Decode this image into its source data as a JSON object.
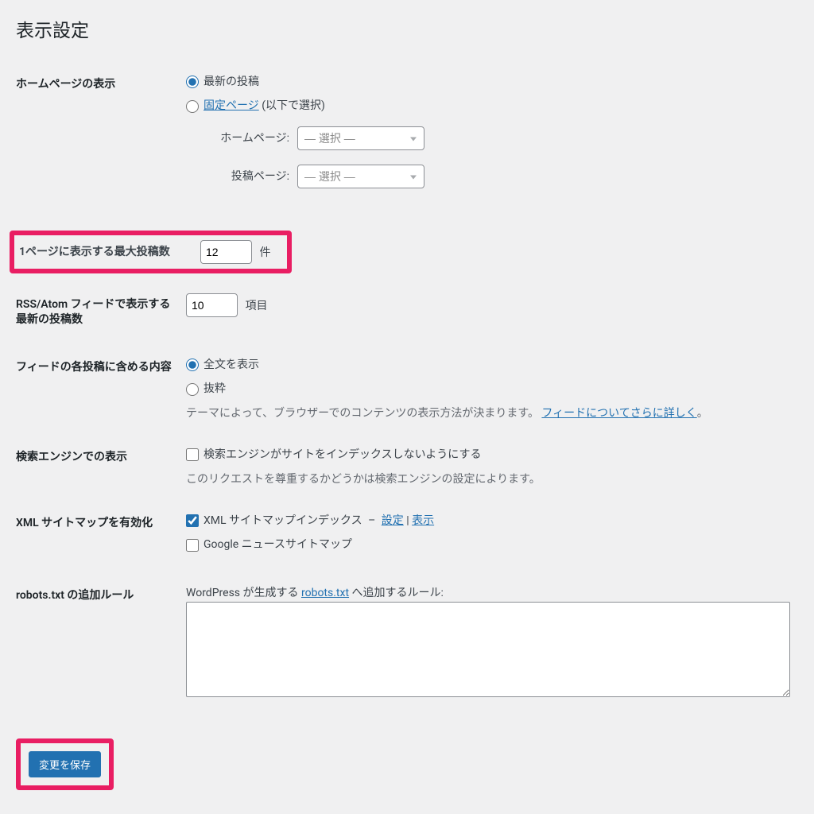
{
  "page": {
    "title": "表示設定"
  },
  "homepage": {
    "label": "ホームページの表示",
    "opt_latest": "最新の投稿",
    "opt_static_link": "固定ページ",
    "opt_static_suffix": " (以下で選択)",
    "home_label": "ホームページ:",
    "posts_label": "投稿ページ:",
    "select_placeholder": "— 選択 —"
  },
  "posts_per_page": {
    "label": "1ページに表示する最大投稿数",
    "value": "12",
    "unit": "件"
  },
  "rss": {
    "label": "RSS/Atom フィードで表示する最新の投稿数",
    "value": "10",
    "unit": "項目"
  },
  "feed_content": {
    "label": "フィードの各投稿に含める内容",
    "opt_full": "全文を表示",
    "opt_excerpt": "抜粋",
    "note_prefix": "テーマによって、ブラウザーでのコンテンツの表示方法が決まります。 ",
    "note_link": "フィードについてさらに詳しく",
    "note_suffix": "。"
  },
  "search_engine": {
    "label": "検索エンジンでの表示",
    "checkbox": "検索エンジンがサイトをインデックスしないようにする",
    "note": "このリクエストを尊重するかどうかは検索エンジンの設定によります。"
  },
  "sitemap": {
    "label": "XML サイトマップを有効化",
    "opt_index": "XML サイトマップインデックス",
    "dash": "–",
    "link_settings": "設定",
    "pipe": " | ",
    "link_view": "表示",
    "opt_gnews": "Google ニュースサイトマップ"
  },
  "robots": {
    "label": "robots.txt の追加ルール",
    "desc_prefix": "WordPress が生成する ",
    "desc_link": "robots.txt",
    "desc_suffix": " へ追加するルール:",
    "value": ""
  },
  "save": {
    "button": "変更を保存"
  }
}
